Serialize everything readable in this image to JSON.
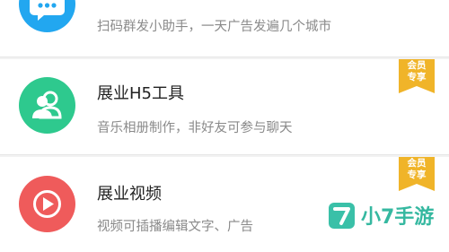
{
  "items": [
    {
      "title": "",
      "desc": "扫码群发小助手，一天广告发遍几个城市",
      "icon": "chat-bubble-icon",
      "icon_color": "#22a7f0",
      "badge": false
    },
    {
      "title": "展业H5工具",
      "desc": "音乐相册制作，非好友可参与聊天",
      "icon": "people-icon",
      "icon_color": "#2ec98e",
      "badge": true
    },
    {
      "title": "展业视频",
      "desc": "视频可插播编辑文字、广告",
      "icon": "play-icon",
      "icon_color": "#ef5b5b",
      "badge": true
    }
  ],
  "badge_text": "会员\n专享",
  "badge_color": "#f0b429",
  "watermark": {
    "text": "小7手游",
    "logo_glyph": "7",
    "color": "#3ac0a8"
  }
}
